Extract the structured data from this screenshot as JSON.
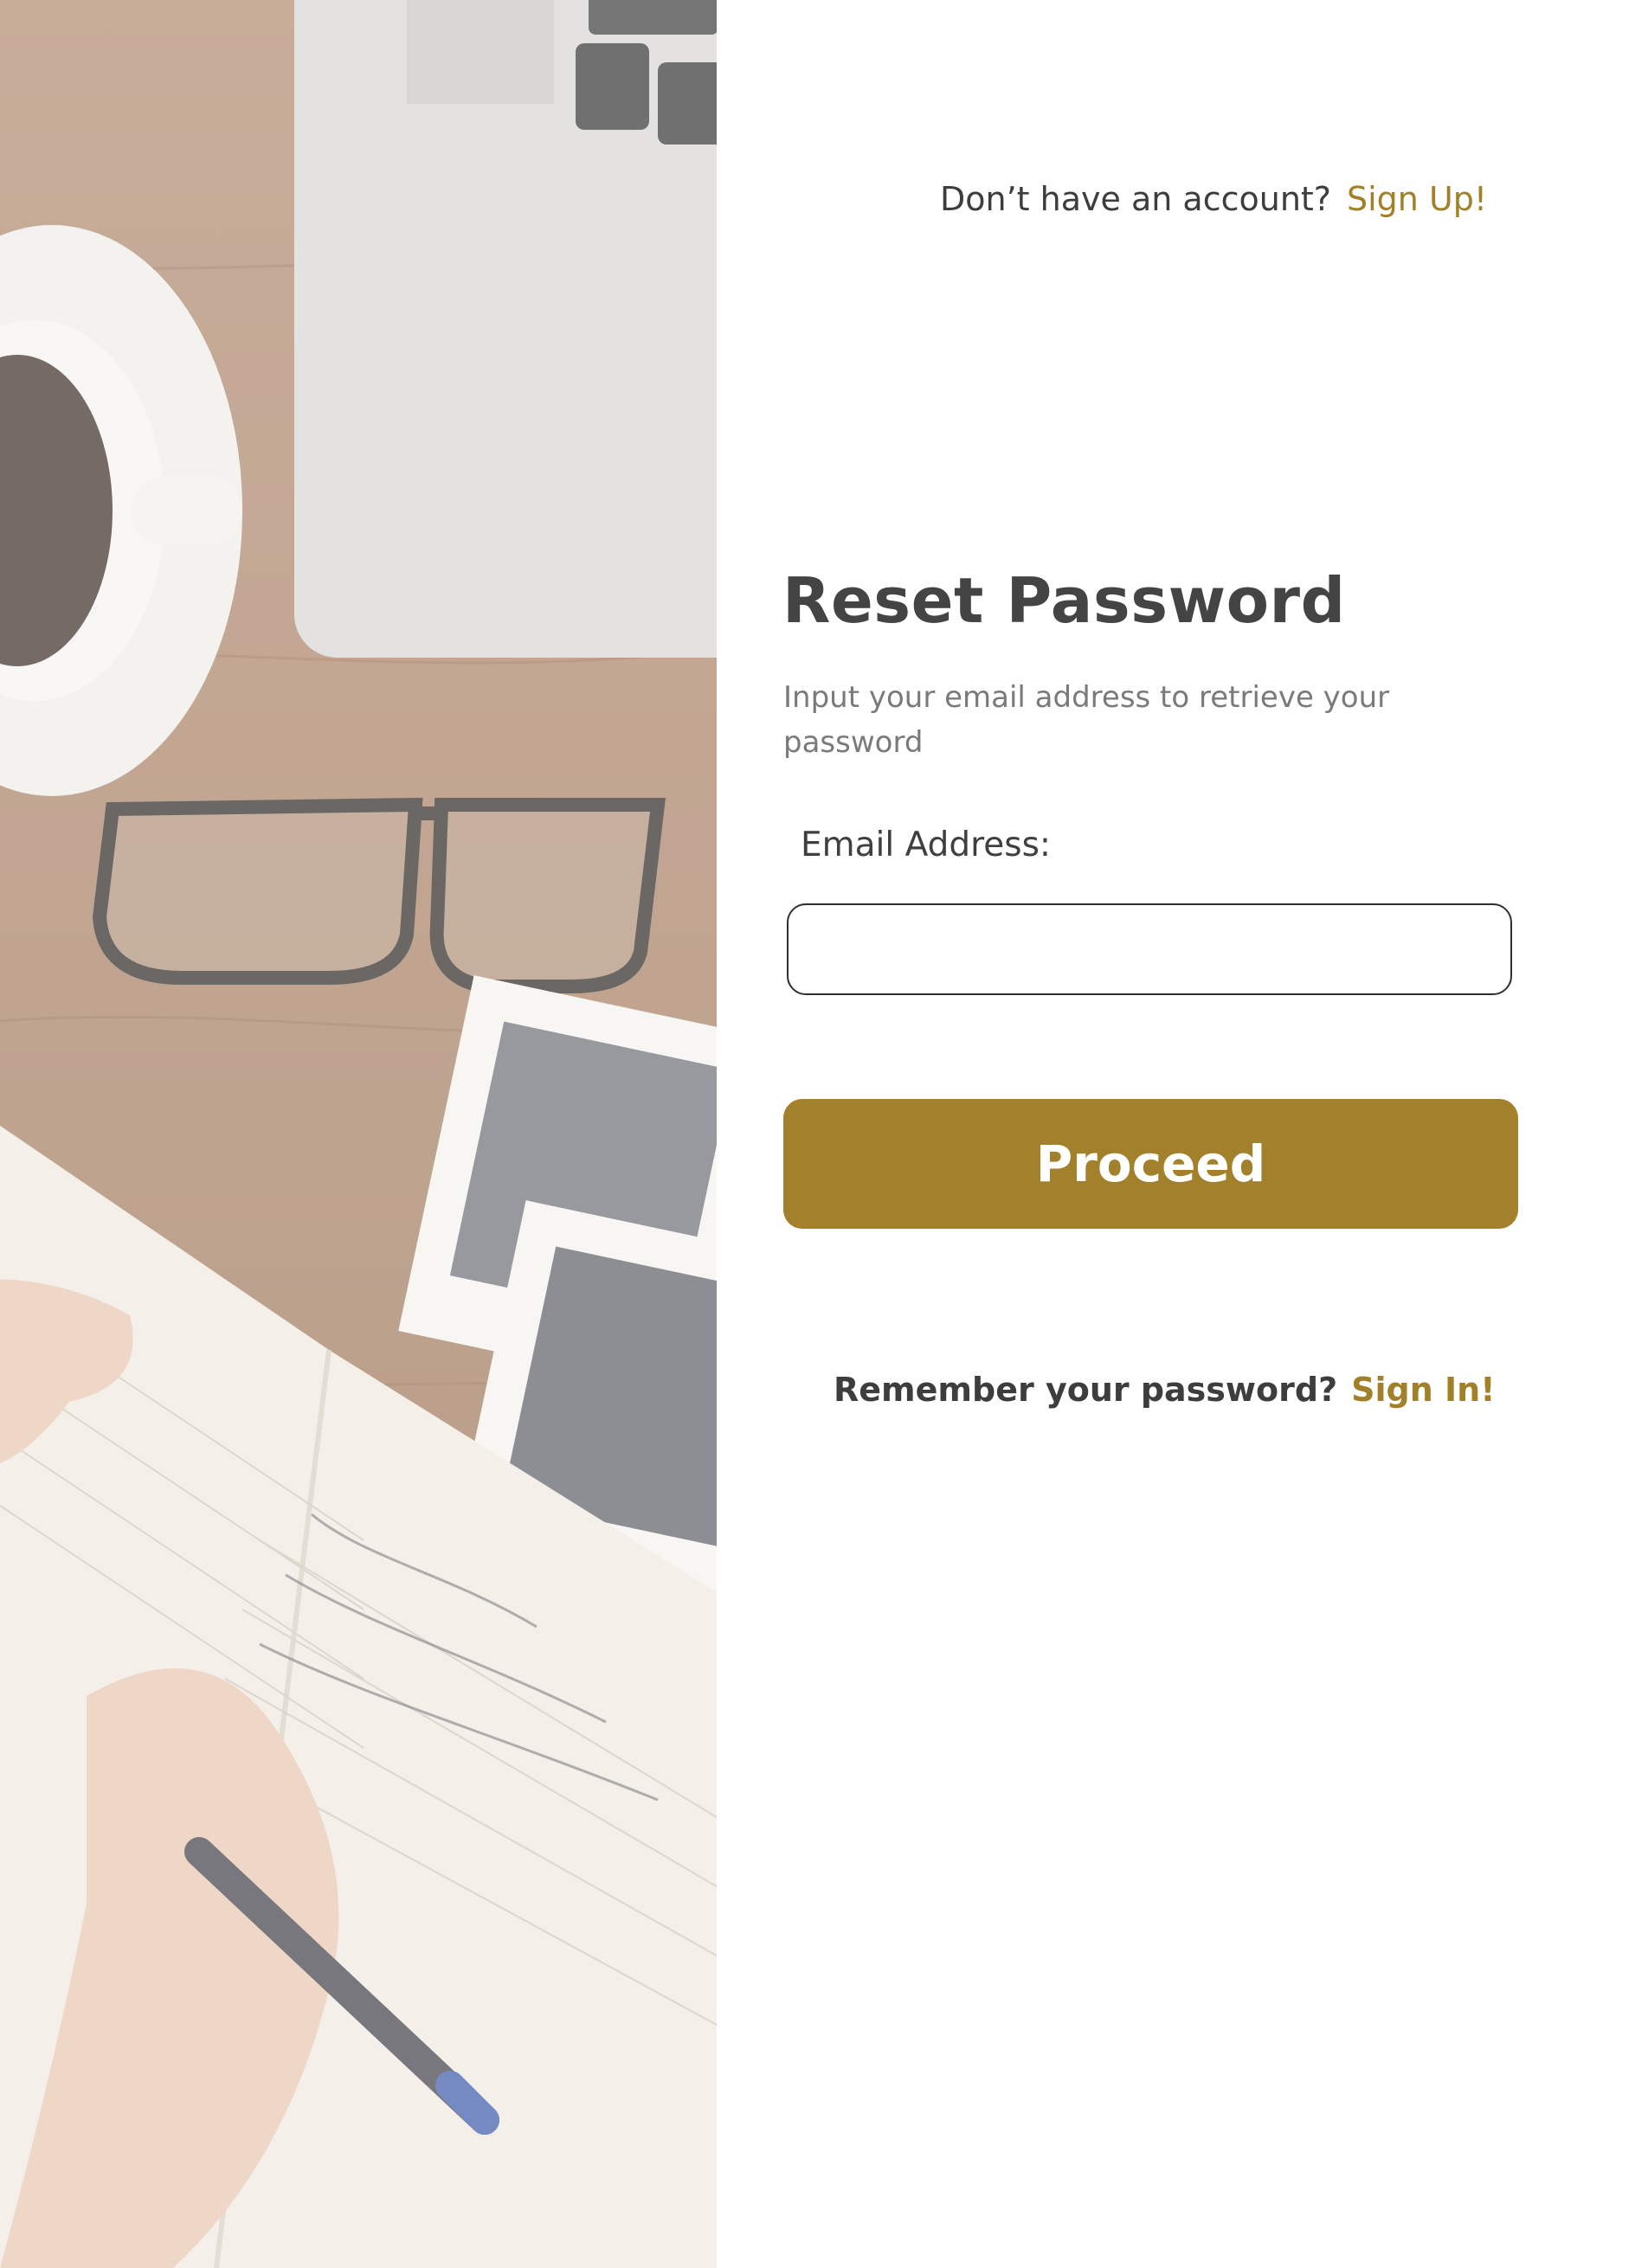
{
  "header": {
    "prompt_text": "Don’t have an account?",
    "signup_link": "Sign Up!"
  },
  "form": {
    "title": "Reset Password",
    "subtitle": "Input your email address to retrieve your password",
    "email_label": "Email Address:",
    "email_value": "",
    "email_placeholder": "",
    "proceed_label": "Proceed"
  },
  "footer": {
    "prompt_text": "Remember your password?",
    "signin_link": "Sign In!"
  },
  "colors": {
    "accent": "#a3812c",
    "link": "#a1802a",
    "text": "#3f3f3f"
  }
}
